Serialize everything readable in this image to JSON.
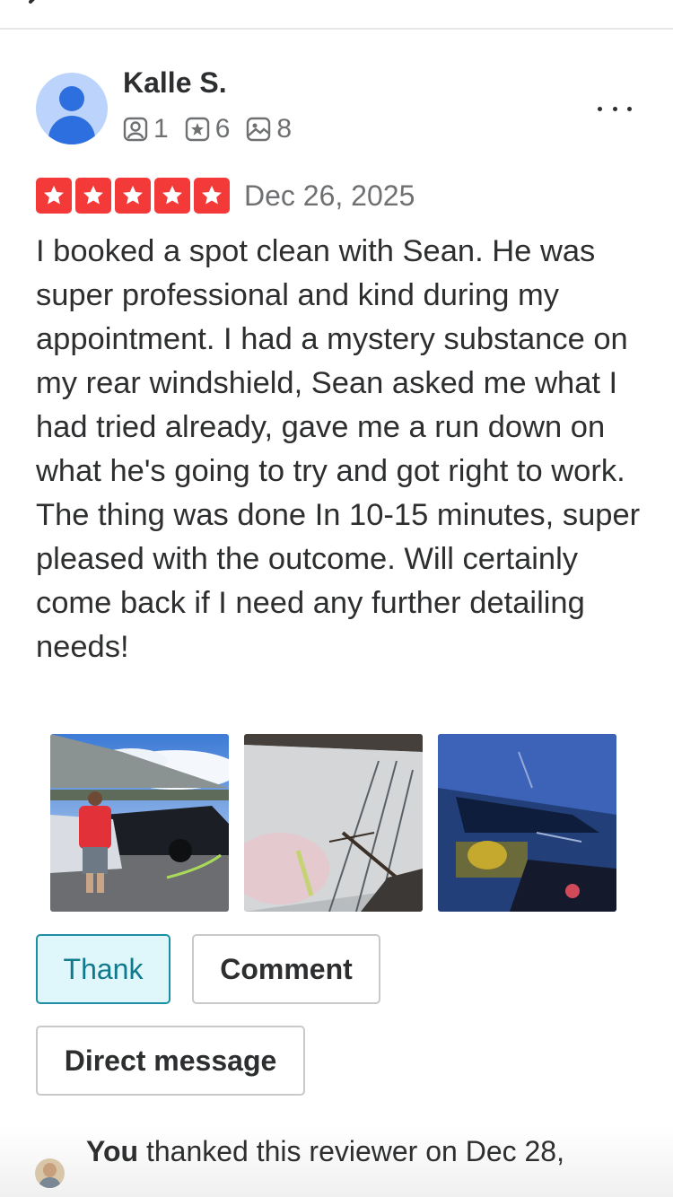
{
  "reviewer": {
    "name": "Kalle S.",
    "stats": [
      {
        "icon": "friends-icon",
        "value": "1"
      },
      {
        "icon": "reviews-icon",
        "value": "6"
      },
      {
        "icon": "photos-icon",
        "value": "8"
      }
    ]
  },
  "review": {
    "rating": 5,
    "rating_color": "#f43939",
    "date": "Dec 26, 2025",
    "text": "I booked a spot clean with Sean. He was super professional and kind during my appointment. I had a mystery substance on my rear windshield, Sean asked me what I had tried already, gave me a run down on what he's going to try and got right to work. The thing was done In 10-15 minutes, super pleased with the outcome. Will certainly come back if I need any further detailing needs!",
    "photo_count": 3
  },
  "actions": {
    "thank_label": "Thank",
    "comment_label": "Comment",
    "direct_message_label": "Direct message"
  },
  "footer": {
    "actor": "You",
    "message": " thanked this reviewer on Dec 28,"
  },
  "colors": {
    "accent": "#11798d",
    "thank_bg": "#dff6fb",
    "text": "#2d2e2f",
    "muted": "#6e7072"
  }
}
